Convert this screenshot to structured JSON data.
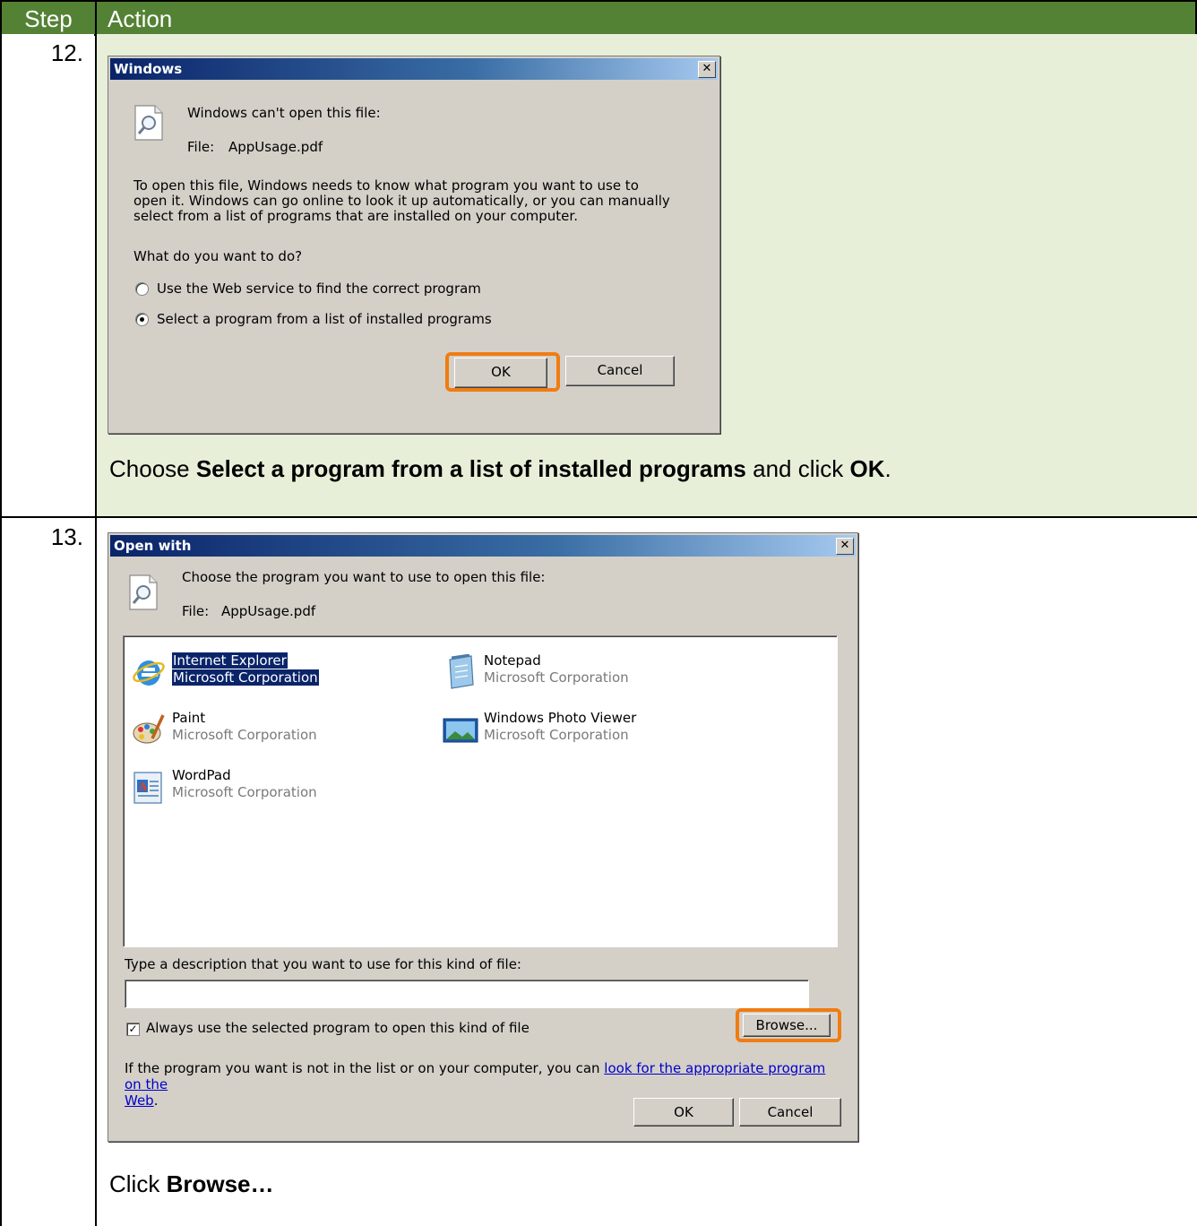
{
  "table": {
    "header": {
      "step": "Step",
      "action": "Action"
    },
    "rows": [
      {
        "step": "12.",
        "caption_pre": "Choose ",
        "caption_bold1": "Select a program from a list of installed programs",
        "caption_mid": " and click ",
        "caption_bold2": "OK",
        "caption_post": "."
      },
      {
        "step": "13.",
        "caption_pre": "Click ",
        "caption_bold1": "Browse…"
      }
    ]
  },
  "dialog_windows": {
    "title": "Windows",
    "close": "✕",
    "heading": "Windows can't open this file:",
    "file_label": "File:",
    "file_name": "AppUsage.pdf",
    "para1": "To open this file, Windows needs to know what program you want to use to",
    "para2": "open it. Windows can go online to look it up automatically, or you can manually",
    "para3": "select from a list of programs that are installed on your computer.",
    "question": "What do you want to do?",
    "options": [
      {
        "label": "Use the Web service to find the correct program",
        "selected": false
      },
      {
        "label": "Select a program from a list of installed programs",
        "selected": true
      }
    ],
    "ok": "OK",
    "cancel": "Cancel",
    "highlight_color": "#f07c12"
  },
  "dialog_openwith": {
    "title": "Open with",
    "close": "✕",
    "heading": "Choose the program you want to use to open this file:",
    "file_label": "File:",
    "file_name": "AppUsage.pdf",
    "programs": [
      {
        "name": "Internet Explorer",
        "company": "Microsoft Corporation",
        "icon": "internet-explorer-icon",
        "selected": true
      },
      {
        "name": "Notepad",
        "company": "Microsoft Corporation",
        "icon": "notepad-icon",
        "selected": false
      },
      {
        "name": "Paint",
        "company": "Microsoft Corporation",
        "icon": "paint-icon",
        "selected": false
      },
      {
        "name": "Windows Photo Viewer",
        "company": "Microsoft Corporation",
        "icon": "photo-viewer-icon",
        "selected": false
      },
      {
        "name": "WordPad",
        "company": "Microsoft Corporation",
        "icon": "wordpad-icon",
        "selected": false
      }
    ],
    "desc_label": "Type a description that you want to use for this kind of file:",
    "desc_value": "",
    "always_label": "Always use the selected program to open this kind of file",
    "always_checked": true,
    "browse": "Browse...",
    "note_text": "If the program you want is not in the list or on your computer, you can ",
    "note_link1": "look for the appropriate program on the",
    "note_link2": "Web",
    "note_end": ".",
    "ok": "OK",
    "cancel": "Cancel"
  }
}
